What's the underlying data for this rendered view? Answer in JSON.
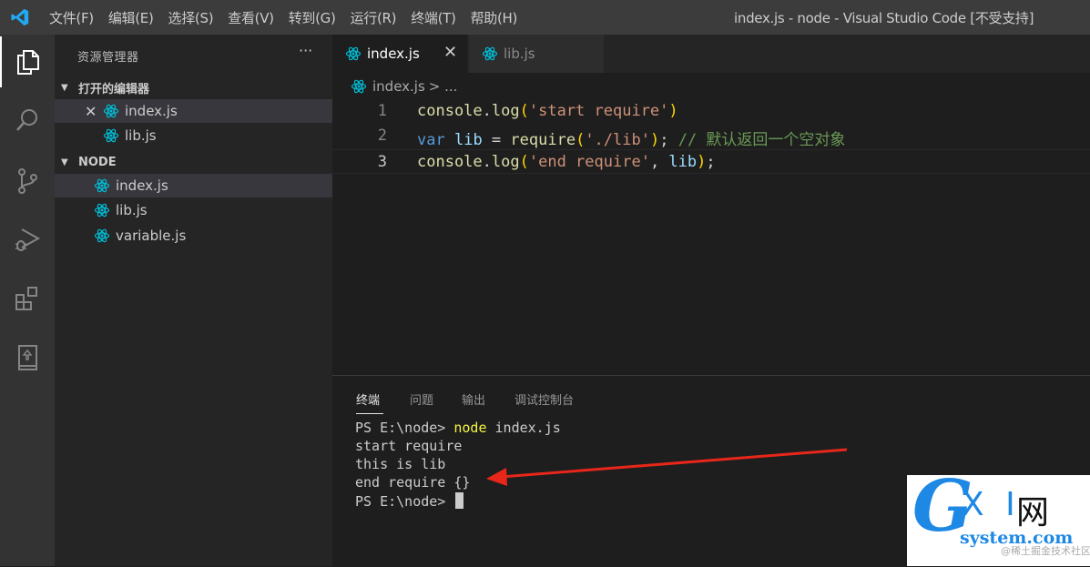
{
  "window": {
    "menu": [
      "文件(F)",
      "编辑(E)",
      "选择(S)",
      "查看(V)",
      "转到(G)",
      "运行(R)",
      "终端(T)",
      "帮助(H)"
    ],
    "title": "index.js - node - Visual Studio Code [不受支持]"
  },
  "activity_bar": [
    "explorer-icon",
    "search-icon",
    "source-control-icon",
    "run-debug-icon",
    "extensions-icon",
    "notebook-icon"
  ],
  "sidebar": {
    "title": "资源管理器",
    "more": "···",
    "open_editors": {
      "label": "打开的编辑器",
      "close_mark": "✕",
      "files": [
        "index.js",
        "lib.js"
      ]
    },
    "folder": {
      "label": "NODE",
      "files": [
        "index.js",
        "lib.js",
        "variable.js"
      ]
    }
  },
  "tabs": [
    {
      "label": "index.js",
      "active": true,
      "close": "✕"
    },
    {
      "label": "lib.js",
      "active": false
    }
  ],
  "breadcrumb": {
    "file": "index.js",
    "rest": "> ..."
  },
  "editor": {
    "line_numbers": [
      "1",
      "2",
      "3"
    ],
    "lines": [
      [
        [
          "f",
          "console"
        ],
        [
          "w",
          "."
        ],
        [
          "f",
          "log"
        ],
        [
          "p",
          "("
        ],
        [
          "s",
          "'start require'"
        ],
        [
          "p",
          ")"
        ]
      ],
      [
        [
          "k",
          "var"
        ],
        [
          "w",
          " "
        ],
        [
          "v",
          "lib"
        ],
        [
          "w",
          " = "
        ],
        [
          "f",
          "require"
        ],
        [
          "p",
          "("
        ],
        [
          "s",
          "'./lib'"
        ],
        [
          "p",
          ")"
        ],
        [
          "w",
          "; "
        ],
        [
          "c",
          "// "
        ],
        [
          "c-cjk",
          "默认返回一个空对象"
        ]
      ],
      [
        [
          "f",
          "console"
        ],
        [
          "w",
          "."
        ],
        [
          "f",
          "log"
        ],
        [
          "p",
          "("
        ],
        [
          "s",
          "'end require'"
        ],
        [
          "w",
          ", "
        ],
        [
          "v",
          "lib"
        ],
        [
          "p",
          ")"
        ],
        [
          "w",
          ";"
        ]
      ]
    ]
  },
  "panel": {
    "tabs": [
      "终端",
      "问题",
      "输出",
      "调试控制台"
    ],
    "terminal": [
      {
        "prompt": "PS E:\\node> ",
        "cmd": "node",
        "rest": " index.js"
      },
      {
        "text": "start require"
      },
      {
        "text": "this is lib"
      },
      {
        "text": "end require {}"
      },
      {
        "prompt": "PS E:\\node> ",
        "cursor": true
      }
    ]
  },
  "watermark": {
    "g": "G",
    "xi": "X I",
    "net": "网",
    "domain": "system.com",
    "sub": "@稀土掘金技术社区"
  },
  "colors": {
    "accent": "#007acc",
    "react": "#00bcd4",
    "arrow": "#e8261a"
  }
}
